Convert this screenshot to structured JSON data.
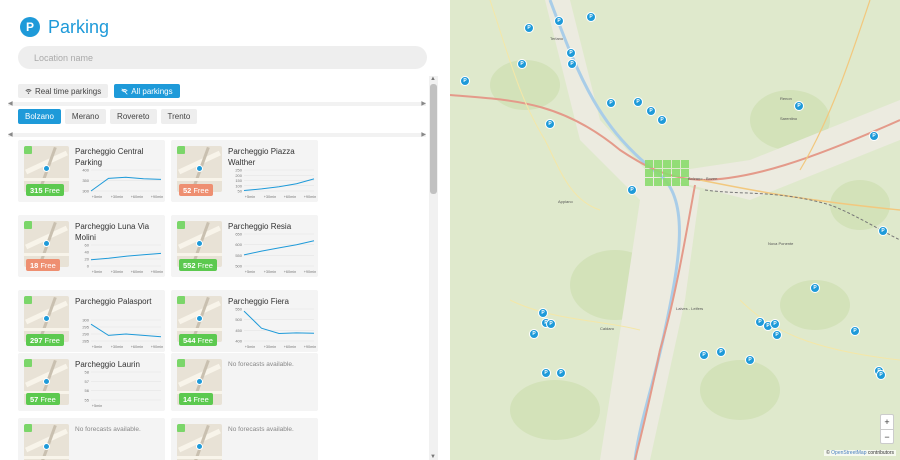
{
  "app": {
    "logo_letter": "P",
    "title": "Parking"
  },
  "search": {
    "placeholder": "Location name"
  },
  "toggles": [
    {
      "label": "Real time parkings",
      "active": false
    },
    {
      "label": "All parkings",
      "active": true
    }
  ],
  "cities": [
    "Bolzano",
    "Merano",
    "Rovereto",
    "Trento"
  ],
  "cards": [
    {
      "name": "Parcheggio Central Parking",
      "free": "315",
      "free_label": "Free",
      "status": "green",
      "forecast": {
        "yticks": [
          "400",
          "350",
          "300"
        ],
        "xticks": [
          "+5min",
          "+30min",
          "+60min",
          "+90min"
        ],
        "values": [
          300,
          360,
          365,
          358,
          355
        ]
      }
    },
    {
      "name": "Parcheggio Piazza Walther",
      "free": "52",
      "free_label": "Free",
      "status": "orange",
      "forecast": {
        "yticks": [
          "250",
          "200",
          "150",
          "100",
          "50"
        ],
        "xticks": [
          "+5min",
          "+30min",
          "+60min",
          "+90min"
        ],
        "values": [
          55,
          70,
          90,
          120,
          165
        ]
      }
    },
    {
      "name": "Parcheggio Luna Via Molini",
      "free": "18",
      "free_label": "Free",
      "status": "orange",
      "forecast": {
        "yticks": [
          "60",
          "40",
          "20",
          "0"
        ],
        "xticks": [
          "+5min",
          "+30min",
          "+60min",
          "+90min"
        ],
        "values": [
          18,
          22,
          28,
          32,
          36
        ]
      }
    },
    {
      "name": "Parcheggio Resia",
      "free": "552",
      "free_label": "Free",
      "status": "green",
      "forecast": {
        "yticks": [
          "650",
          "600",
          "550",
          "500"
        ],
        "xticks": [
          "+5min",
          "+30min",
          "+60min",
          "+90min"
        ],
        "values": [
          552,
          570,
          585,
          600,
          618
        ]
      }
    },
    {
      "name": "Parcheggio Palasport",
      "free": "297",
      "free_label": "Free",
      "status": "green",
      "forecast": {
        "yticks": [
          "300",
          "295",
          "290",
          "285"
        ],
        "xticks": [
          "+5min",
          "+30min",
          "+60min",
          "+90min"
        ],
        "values": [
          297,
          289,
          290,
          289,
          288
        ]
      }
    },
    {
      "name": "Parcheggio Fiera",
      "free": "544",
      "free_label": "Free",
      "status": "green",
      "forecast": {
        "yticks": [
          "550",
          "500",
          "450",
          "400"
        ],
        "xticks": [
          "+5min",
          "+30min",
          "+60min",
          "+90min"
        ],
        "values": [
          540,
          460,
          435,
          438,
          436
        ]
      }
    },
    {
      "name": "Parcheggio Laurin",
      "free": "57",
      "free_label": "Free",
      "status": "green",
      "forecast": {
        "yticks": [
          "58",
          "57",
          "56",
          "55"
        ],
        "xticks": [
          "+5min"
        ],
        "values": []
      }
    },
    {
      "name": "",
      "free": "14",
      "free_label": "Free",
      "status": "green",
      "no_forecast": "No forecasts available."
    },
    {
      "name": "",
      "free": "",
      "free_label": "",
      "status": "green",
      "no_forecast": "No forecasts available."
    },
    {
      "name": "",
      "free": "",
      "free_label": "",
      "status": "green",
      "no_forecast": "No forecasts available."
    }
  ],
  "map": {
    "attribution_link": "OpenStreetMap",
    "attribution_rest": "contributors",
    "zoom_in": "+",
    "zoom_out": "−",
    "pin_glyph": "P"
  },
  "colors": {
    "accent": "#1e9ad9",
    "free_green": "#5cc94f",
    "free_orange": "#ee8f71"
  }
}
